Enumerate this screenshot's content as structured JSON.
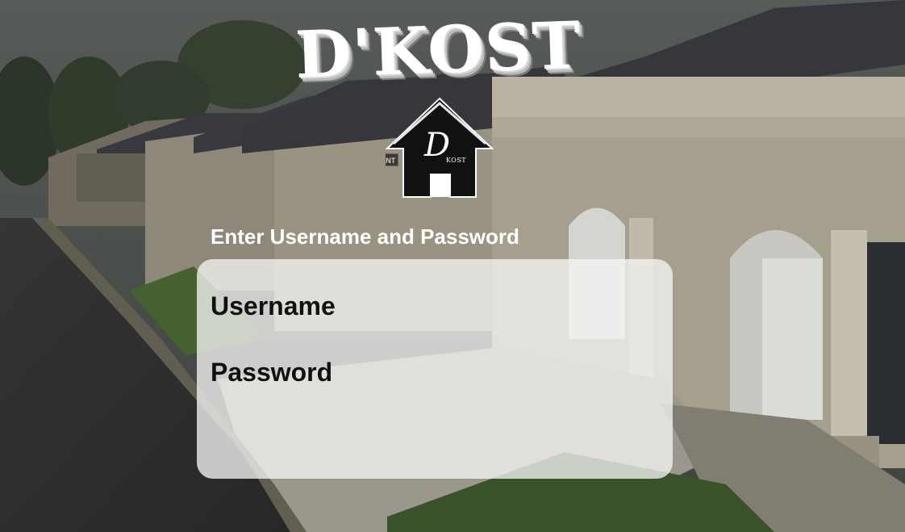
{
  "app": {
    "brand_title": "D'KOST",
    "logo_letter": "D",
    "logo_subtext": "KOST",
    "rent_sign": "RENT"
  },
  "login": {
    "prompt": "Enter Username and Password",
    "username_label": "Username",
    "username_value": "",
    "password_label": "Password",
    "password_value": ""
  },
  "colors": {
    "title_text": "#ffffff",
    "panel_background": "#f4f4f2",
    "label_text": "#111111",
    "logo_house": "#111111"
  }
}
